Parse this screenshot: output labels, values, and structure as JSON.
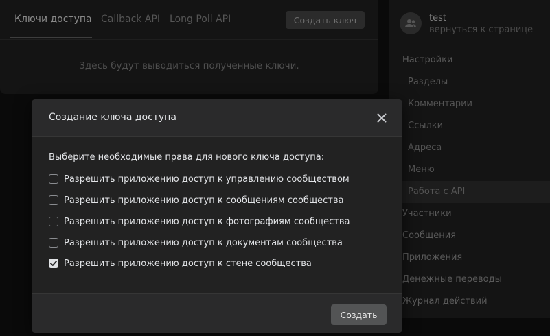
{
  "page": {
    "tabs": [
      {
        "label": "Ключи доступа",
        "active": true
      },
      {
        "label": "Callback API",
        "active": false
      },
      {
        "label": "Long Poll API",
        "active": false
      }
    ],
    "create_key_label": "Создать ключ",
    "empty_message": "Здесь будут выводиться полученные ключи."
  },
  "sidebar": {
    "profile": {
      "name": "test",
      "back_link": "вернуться к странице",
      "avatar_icon": "users-icon"
    },
    "settings_heading": "Настройки",
    "settings_items": [
      {
        "label": "Разделы"
      },
      {
        "label": "Комментарии"
      },
      {
        "label": "Ссылки"
      },
      {
        "label": "Адреса"
      },
      {
        "label": "Меню"
      },
      {
        "label": "Работа с API",
        "active": true
      }
    ],
    "sections": [
      {
        "label": "Участники"
      },
      {
        "label": "Сообщения"
      },
      {
        "label": "Приложения"
      },
      {
        "label": "Денежные переводы"
      },
      {
        "label": "Журнал действий"
      }
    ]
  },
  "modal": {
    "title": "Создание ключа доступа",
    "close_icon": "close-icon",
    "prompt": "Выберите необходимые права для нового ключа доступа:",
    "permissions": [
      {
        "label": "Разрешить приложению доступ к управлению сообществом",
        "checked": false
      },
      {
        "label": "Разрешить приложению доступ к сообщениям сообщества",
        "checked": false
      },
      {
        "label": "Разрешить приложению доступ к фотографиям сообщества",
        "checked": false
      },
      {
        "label": "Разрешить приложению доступ к документам сообщества",
        "checked": false
      },
      {
        "label": "Разрешить приложению доступ к стене сообщества",
        "checked": true
      }
    ],
    "submit_label": "Создать"
  },
  "colors": {
    "modal_bg": "#222222",
    "modal_header_bg": "#2a2a2b",
    "button_bg": "#535455",
    "text": "#e1e3e6"
  }
}
